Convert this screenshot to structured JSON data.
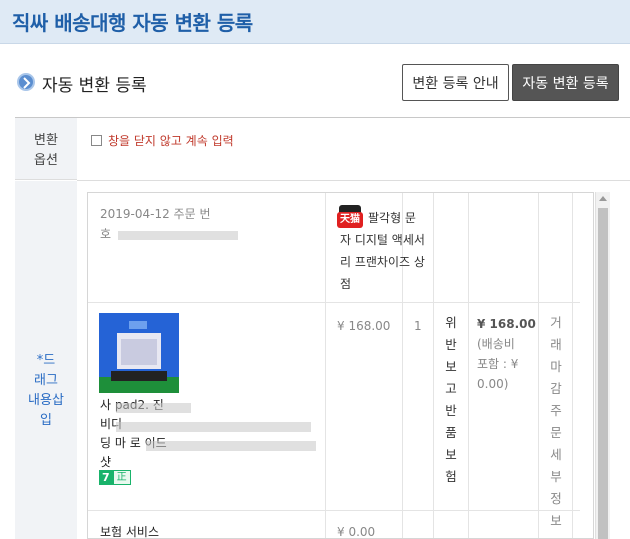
{
  "header": {
    "title": "직싸 배송대행 자동 변환 등록"
  },
  "section": {
    "title": "자동 변환 등록"
  },
  "buttons": {
    "guide": "변환 등록 안내",
    "register": "자동 변환 등록"
  },
  "form": {
    "option_label": "변환\n옵션",
    "keep_open_checkbox": {
      "label": "창을 닫지 않고 계속 입력",
      "checked": false
    },
    "drag_label": "*드\n래그\n내용삽\n입"
  },
  "order": {
    "info": "2019-04-12 주문 번\n호",
    "shop_badge": "天猫",
    "shop_name": "팔각형 문\n자 디지털 액세서\n리 프랜차이즈 상\n점",
    "price": "¥ 168.00",
    "quantity": "1",
    "policy": "위반보고반품보험",
    "total_amount": "¥ 168.00",
    "total_note": "(배송비\n포함 : ¥\n0.00)",
    "closing": "거래마감주문세부정보",
    "product_name": "사 pad2. 진\n비디\n딩 마 로 이드\n샷",
    "tags": [
      "7",
      "正"
    ],
    "service_name": "보험 서비스",
    "service_price": "¥ 0.00"
  },
  "colors": {
    "accent": "#1f5fa8",
    "header_bg": "#dfeaf5",
    "dark_button": "#555555",
    "tmall_red": "#e02020",
    "tag_green": "#19b36b"
  }
}
